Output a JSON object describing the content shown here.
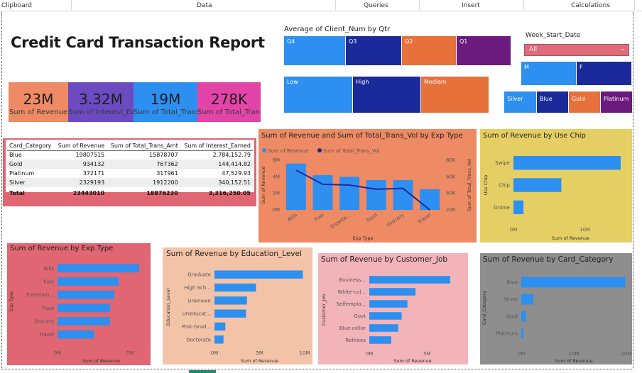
{
  "ribbon": {
    "items": [
      "Clipboard",
      "Data",
      "Queries",
      "Insert",
      "Calculations"
    ]
  },
  "report": {
    "title": "Credit Card Transaction Report"
  },
  "kpis": [
    {
      "value": "23M",
      "label": "Sum of Revenue",
      "color": "#ee8a64"
    },
    {
      "value": "3.32M",
      "label": "Sum of Interest_Earned",
      "color": "#6c4bc1"
    },
    {
      "value": "19M",
      "label": "Sum of Total_Trans_Amt",
      "color": "#2d8ff0"
    },
    {
      "value": "278K",
      "label": "Sum of Total_Trans_Vol",
      "color": "#e344a8"
    }
  ],
  "treemap_qtr": {
    "title": "Average of Client_Num by Qtr",
    "tiles": [
      {
        "label": "Q4",
        "color": "#2d8ff0"
      },
      {
        "label": "Q3",
        "color": "#1a2a9a"
      },
      {
        "label": "Q2",
        "color": "#e8703a"
      },
      {
        "label": "Q1",
        "color": "#6b1a7e"
      }
    ]
  },
  "treemap_income": {
    "tiles": [
      {
        "label": "Low",
        "color": "#2d8ff0"
      },
      {
        "label": "High",
        "color": "#1a2a9a"
      },
      {
        "label": "Mediam",
        "color": "#e8703a"
      }
    ]
  },
  "slicer": {
    "title": "Week_Start_Date",
    "value": "All"
  },
  "treemap_gender": {
    "tiles": [
      {
        "label": "M",
        "color": "#2d8ff0"
      },
      {
        "label": "F",
        "color": "#1a2a9a"
      }
    ]
  },
  "treemap_card": {
    "tiles": [
      {
        "label": "Silver",
        "color": "#2d8ff0"
      },
      {
        "label": "Blue",
        "color": "#1a2a9a"
      },
      {
        "label": "Gold",
        "color": "#e8703a"
      },
      {
        "label": "Platinum",
        "color": "#6b1a7e"
      }
    ]
  },
  "matrix": {
    "headers": [
      "Card_Category",
      "Sum of Revenue",
      "Sum of Total_Trans_Amt",
      "Sum of Interest_Earned"
    ],
    "rows": [
      [
        "Blue",
        "19807515",
        "15878707",
        "2,784,152.79"
      ],
      [
        "Gold",
        "934132",
        "767362",
        "144,414.82"
      ],
      [
        "Platinum",
        "372171",
        "317961",
        "47,529.93"
      ],
      [
        "Silver",
        "2329193",
        "1912200",
        "340,152.51"
      ]
    ],
    "total": [
      "Total",
      "23443010",
      "18876230",
      "3,316,250.05"
    ]
  },
  "chart_data": [
    {
      "type": "bar",
      "title": "Sum of Revenue and Sum of Total_Trans_Vol by Exp Type",
      "xlabel": "Exp Type",
      "ylabel": "Sum of Revenue",
      "y2label": "Sum of Total_Trans_Vol",
      "categories": [
        "Bills",
        "Fuel",
        "Entertainment",
        "Food",
        "Grocery",
        "Travel"
      ],
      "tick_labels": [
        "Bills",
        "Fuel",
        "Enterta...",
        "Food",
        "Grocery",
        "Travel"
      ],
      "series": [
        {
          "name": "Sum of Revenue",
          "kind": "bar",
          "values": [
            5.6,
            4.2,
            4.0,
            3.6,
            3.6,
            2.5
          ],
          "color": "#2d8ff0"
        },
        {
          "name": "Sum of Total_Trans_Vol",
          "kind": "line",
          "values": [
            68,
            51,
            50,
            45,
            46,
            20
          ],
          "color": "#1a2a9a"
        }
      ],
      "ylim": [
        0,
        6
      ],
      "y_ticks": [
        "0M",
        "2M",
        "4M",
        "6M"
      ],
      "y2lim": [
        20,
        80
      ],
      "y2_ticks": [
        "20K",
        "40K",
        "60K",
        "80K"
      ],
      "legend": "top-left"
    },
    {
      "type": "bar",
      "orientation": "horizontal",
      "title": "Sum of Revenue by Use Chip",
      "xlabel": "Sum of Revenue",
      "ylabel": "Use Chip",
      "categories": [
        "Swipe",
        "Chip",
        "Online"
      ],
      "values": [
        15.0,
        6.7,
        1.4
      ],
      "xlim": [
        0,
        16
      ],
      "x_ticks": [
        "0M",
        "10M"
      ],
      "x_tick_values": [
        0,
        10
      ]
    },
    {
      "type": "bar",
      "orientation": "horizontal",
      "title": "Sum of Revenue by Exp Type",
      "xlabel": "Sum of Revenue",
      "ylabel": "Exp Type",
      "categories": [
        "Bills",
        "Fuel",
        "Entertain...",
        "Food",
        "Grocery",
        "Travel"
      ],
      "values": [
        5.6,
        4.2,
        3.9,
        3.6,
        3.6,
        2.5
      ],
      "xlim": [
        0,
        6
      ],
      "x_ticks": [
        "0M",
        "5M"
      ],
      "x_tick_values": [
        0,
        5
      ]
    },
    {
      "type": "bar",
      "orientation": "horizontal",
      "title": "Sum of Revenue by Education_Level",
      "xlabel": "Sum of Revenue",
      "ylabel": "Education_Level",
      "categories": [
        "Graduate",
        "High Sch...",
        "Unknown",
        "Uneducat...",
        "Post-Grad...",
        "Doctorate"
      ],
      "values": [
        9.8,
        4.6,
        3.6,
        3.5,
        1.2,
        1.0
      ],
      "xlim": [
        0,
        10
      ],
      "x_ticks": [
        "0M",
        "5M",
        "10M"
      ],
      "x_tick_values": [
        0,
        5,
        10
      ]
    },
    {
      "type": "bar",
      "orientation": "horizontal",
      "title": "Sum of Revenue by Customer_Job",
      "xlabel": "Sum of Revenue",
      "ylabel": "Customer_Job",
      "categories": [
        "Business...",
        "White-col...",
        "Selfemplo...",
        "Govt",
        "Blue-collar",
        "Retirees"
      ],
      "values": [
        7.0,
        4.0,
        3.3,
        2.8,
        2.5,
        1.9
      ],
      "xlim": [
        0,
        7.5
      ],
      "x_ticks": [
        "0M",
        "5M"
      ],
      "x_tick_values": [
        0,
        5
      ]
    },
    {
      "type": "bar",
      "orientation": "horizontal",
      "title": "Sum of Revenue by Card_Category",
      "xlabel": "Sum of Revenue",
      "ylabel": "Card_Category",
      "categories": [
        "Blue",
        "Silver",
        "Gold",
        "Platinum"
      ],
      "values": [
        19.8,
        2.3,
        0.9,
        0.4
      ],
      "xlim": [
        0,
        20
      ],
      "x_ticks": [
        "0M",
        "10M",
        "20M"
      ],
      "x_tick_values": [
        0,
        10,
        20
      ]
    }
  ]
}
